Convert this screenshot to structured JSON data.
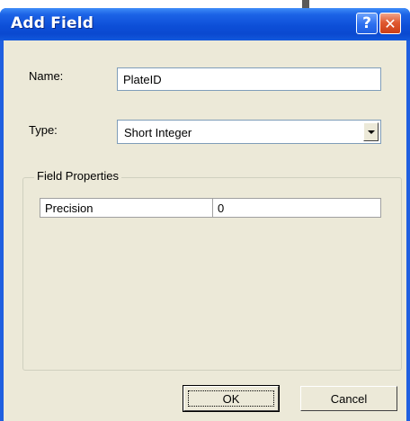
{
  "dialog": {
    "title": "Add Field",
    "help_glyph": "?",
    "close_glyph": "✕"
  },
  "name_field": {
    "label": "Name:",
    "value": "PlateID"
  },
  "type_field": {
    "label": "Type:",
    "selected": "Short Integer"
  },
  "field_properties": {
    "title": "Field Properties",
    "rows": [
      {
        "property": "Precision",
        "value": "0"
      }
    ]
  },
  "buttons": {
    "ok_label": "OK",
    "cancel_label": "Cancel"
  },
  "colors": {
    "title_bar": "#0a49d0",
    "dialog_face": "#ece9d8",
    "close_button": "#e05a32"
  }
}
